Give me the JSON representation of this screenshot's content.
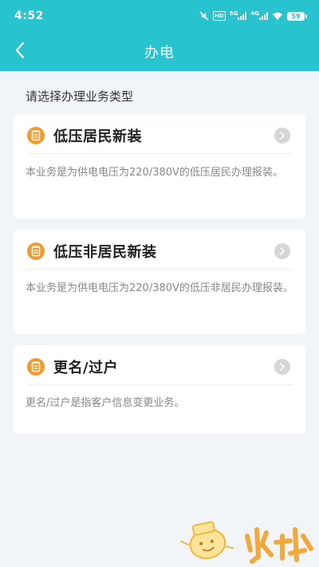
{
  "status_bar": {
    "time": "4:52",
    "hd": "HD",
    "sig1": "5G",
    "sig2": "4G",
    "battery": "59"
  },
  "nav": {
    "title": "办电",
    "back_icon": "chevron-left-icon"
  },
  "section_title": "请选择办理业务类型",
  "cards": [
    {
      "title": "低压居民新装",
      "description": "本业务是为供电电压为220/380V的低压居民办理报装。"
    },
    {
      "title": "低压非居民新装",
      "description": "本业务是为供电电压为220/380V的低压非居民办理报装。"
    },
    {
      "title": "更名/过户",
      "description": "更名/过户是指客户信息变更业务。"
    }
  ],
  "icons": {
    "card_icon": "clipboard-icon",
    "chevron": "chevron-right-icon"
  },
  "colors": {
    "header": "#27c3cf",
    "card_icon": "#f29a2e",
    "background": "#f2f5f8"
  }
}
